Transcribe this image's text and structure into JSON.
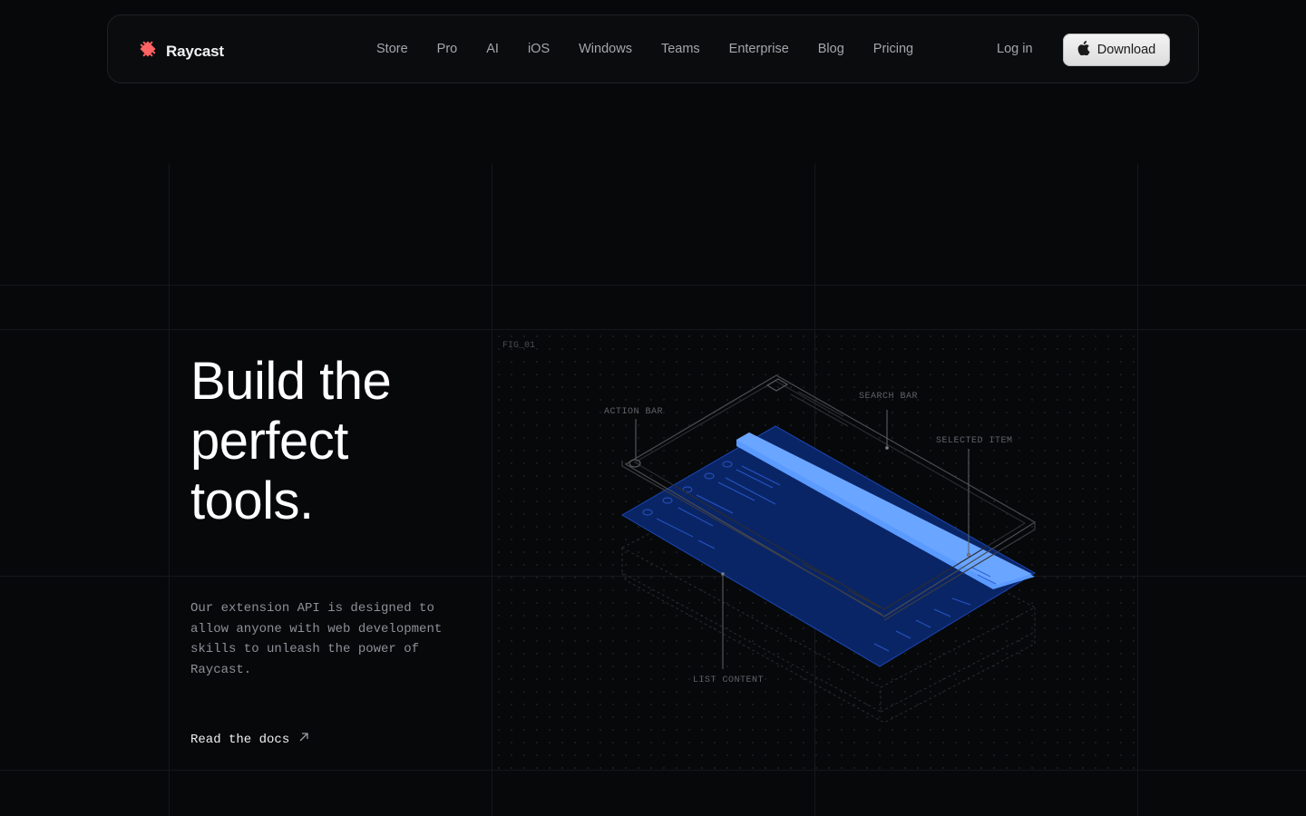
{
  "brand": {
    "name": "Raycast"
  },
  "nav": {
    "links": [
      "Store",
      "Pro",
      "AI",
      "iOS",
      "Windows",
      "Teams",
      "Enterprise",
      "Blog",
      "Pricing"
    ],
    "login_label": "Log in",
    "download_label": "Download"
  },
  "hero": {
    "headline": "Build the perfect tools.",
    "description": "Our extension API is designed to allow anyone with web development skills to unleash the power of Raycast.",
    "docs_link": "Read the docs"
  },
  "figure": {
    "tag": "FIG_01",
    "labels": {
      "action_bar": "ACTION BAR",
      "search_bar": "SEARCH BAR",
      "selected_item": "SELECTED ITEM",
      "list_content": "LIST CONTENT"
    }
  },
  "colors": {
    "brand_red": "#ff6363",
    "accent_blue": "#5b9bff",
    "panel_blue": "#0b2a6b",
    "background": "#07080a"
  }
}
